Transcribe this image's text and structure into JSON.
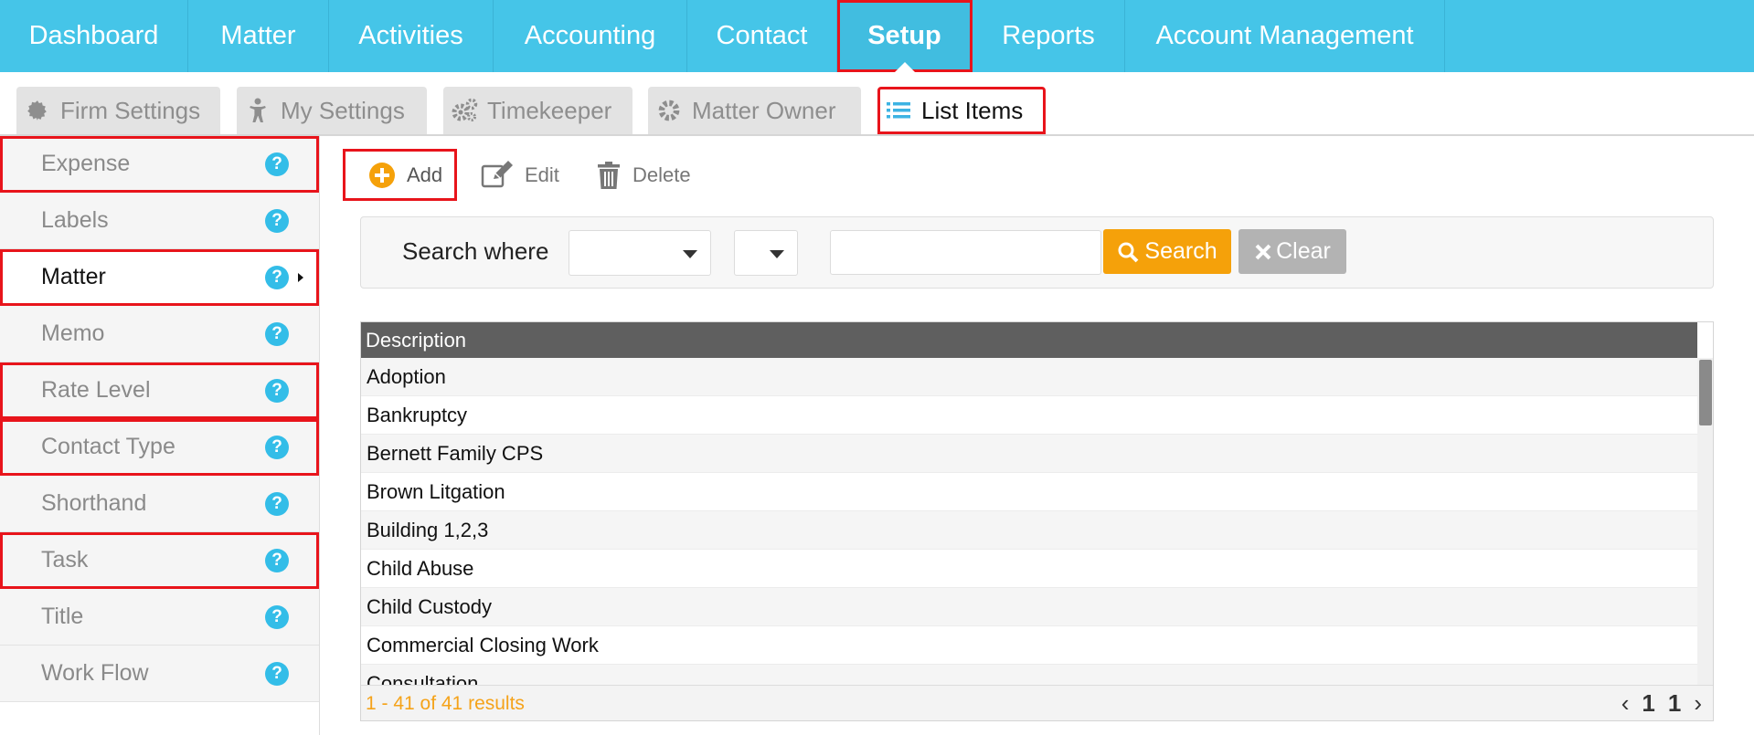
{
  "topnav": {
    "items": [
      {
        "label": "Dashboard"
      },
      {
        "label": "Matter"
      },
      {
        "label": "Activities"
      },
      {
        "label": "Accounting"
      },
      {
        "label": "Contact"
      },
      {
        "label": "Setup",
        "active": true
      },
      {
        "label": "Reports"
      },
      {
        "label": "Account Management"
      }
    ]
  },
  "subtabs": {
    "items": [
      {
        "label": "Firm Settings",
        "icon": "gear-icon"
      },
      {
        "label": "My Settings",
        "icon": "person-icon"
      },
      {
        "label": "Timekeeper",
        "icon": "gears-icon"
      },
      {
        "label": "Matter Owner",
        "icon": "gear-icon"
      },
      {
        "label": "List Items",
        "icon": "list-icon",
        "active": true
      }
    ]
  },
  "sidebar": {
    "items": [
      {
        "label": "Expense",
        "help": "?"
      },
      {
        "label": "Labels",
        "help": "?"
      },
      {
        "label": "Matter",
        "help": "?",
        "active": true
      },
      {
        "label": "Memo",
        "help": "?"
      },
      {
        "label": "Rate Level",
        "help": "?"
      },
      {
        "label": "Contact Type",
        "help": "?"
      },
      {
        "label": "Shorthand",
        "help": "?"
      },
      {
        "label": "Task",
        "help": "?"
      },
      {
        "label": "Title",
        "help": "?"
      },
      {
        "label": "Work Flow",
        "help": "?"
      }
    ]
  },
  "toolbar": {
    "add_label": "Add",
    "edit_label": "Edit",
    "delete_label": "Delete"
  },
  "search": {
    "label": "Search where",
    "field_select_value": "",
    "operator_select_value": "",
    "input_value": "",
    "search_button": "Search",
    "clear_button": "Clear",
    "search_color": "#f5a10a",
    "clear_color": "#b3b3b3"
  },
  "grid": {
    "header": "Description",
    "rows": [
      "Adoption",
      "Bankruptcy",
      "Bernett Family CPS",
      "Brown Litgation",
      "Building 1,2,3",
      "Child Abuse",
      "Child Custody",
      "Commercial Closing Work",
      "Consultation"
    ],
    "results_text": "1 - 41 of 41 results",
    "pager": {
      "prev": "‹",
      "page": "1",
      "total": "1",
      "next": "›"
    }
  },
  "colors": {
    "nav": "#45c5e8",
    "highlight": "#e8141b",
    "help": "#33bde8",
    "accent": "#f5a10a"
  }
}
